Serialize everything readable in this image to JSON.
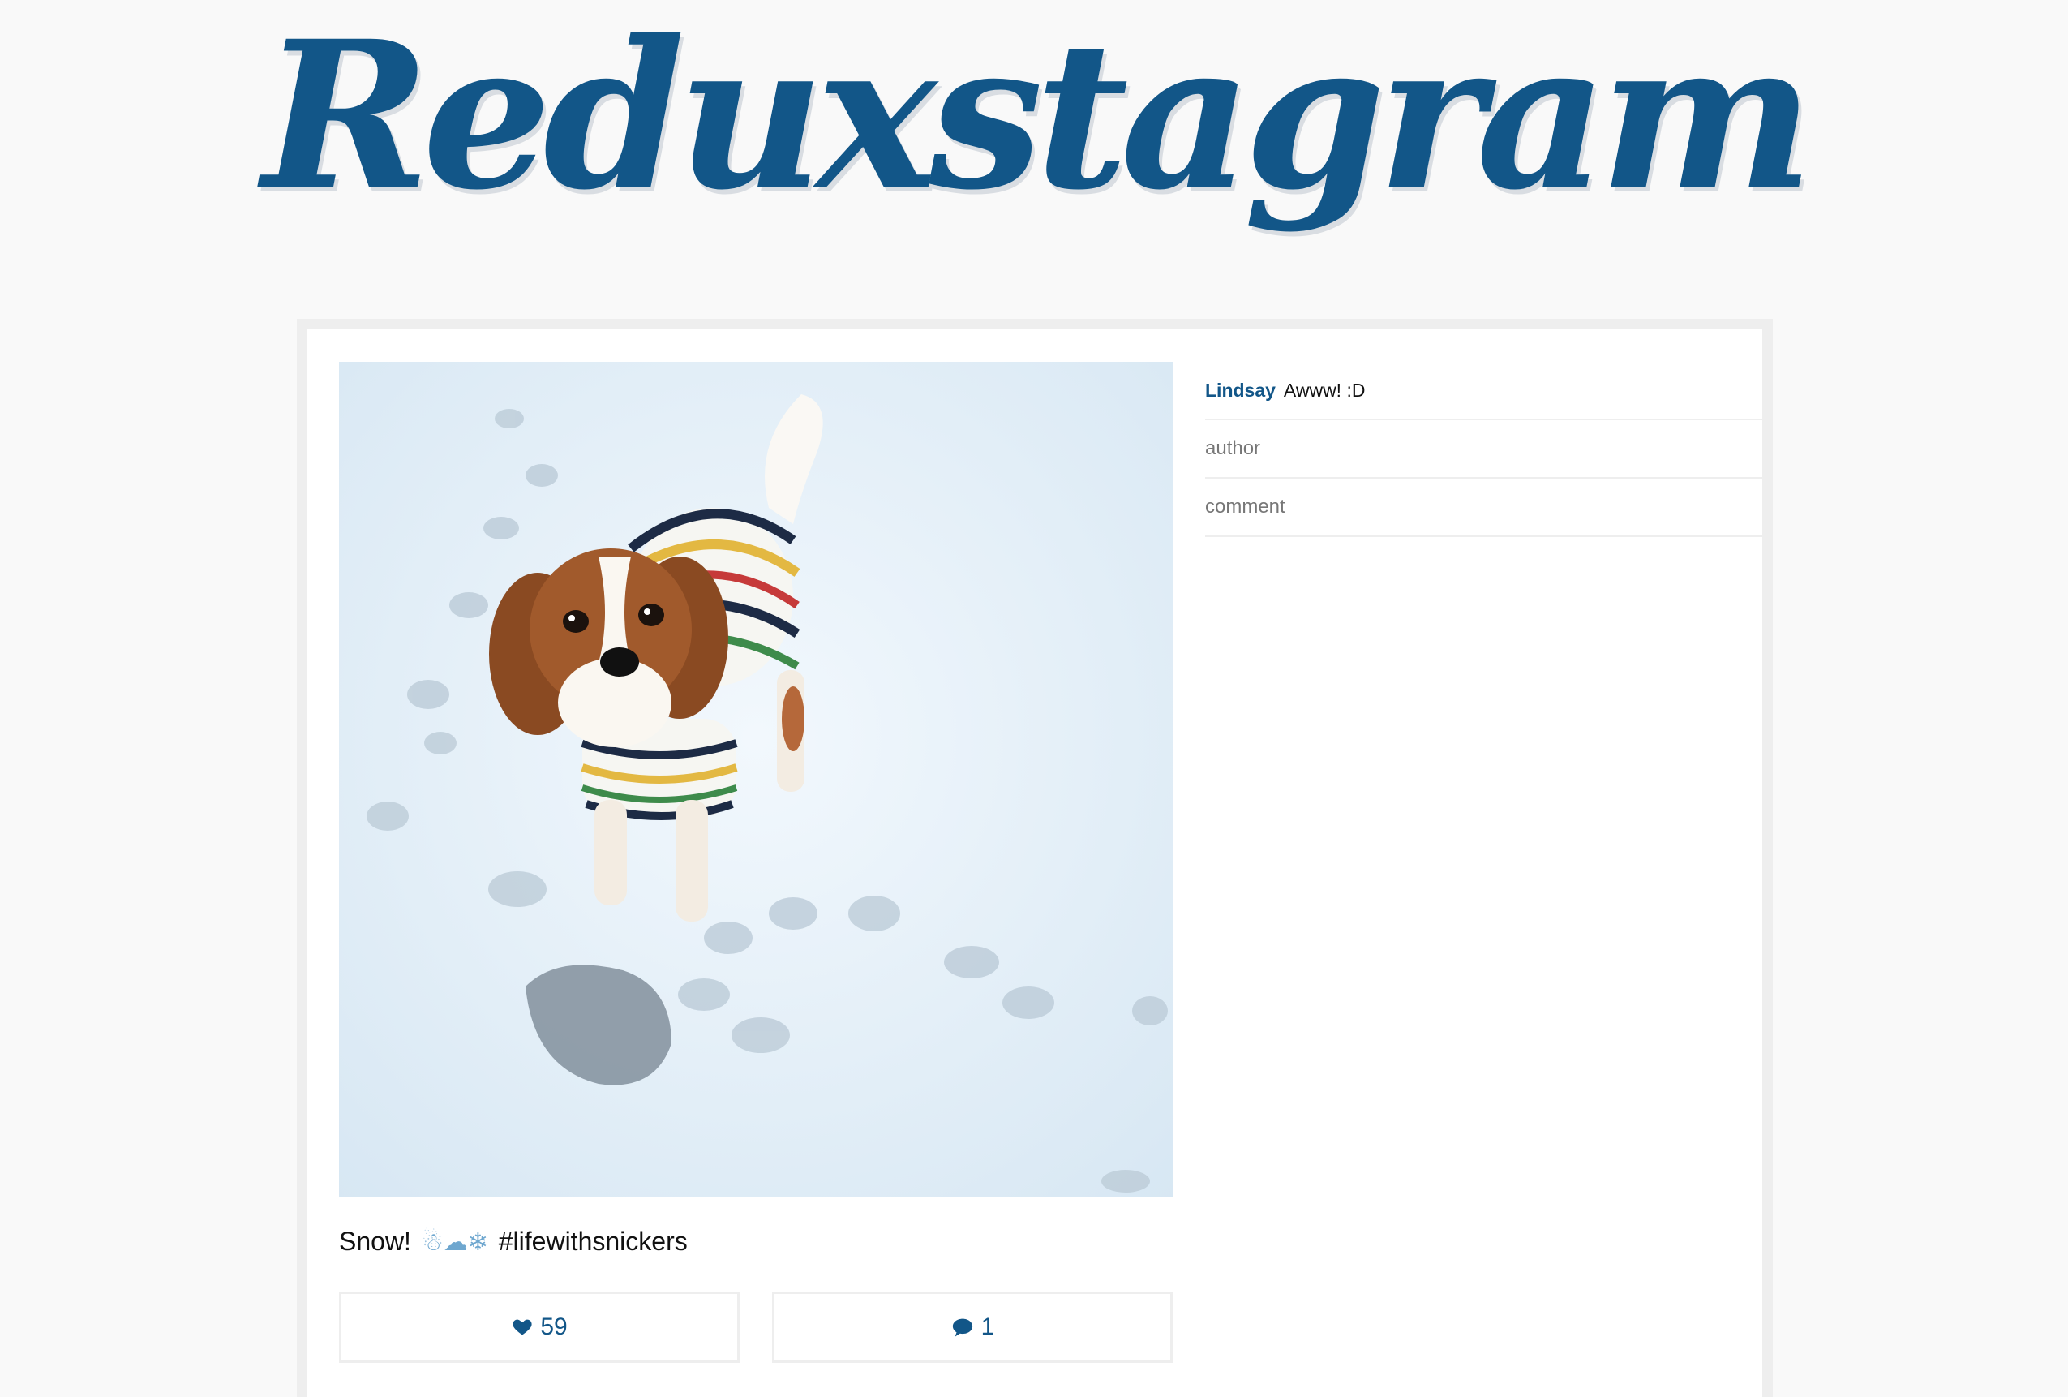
{
  "app": {
    "title": "Reduxstagram",
    "brand_color": "#125688"
  },
  "post": {
    "image_alt": "Dog in striped sweater standing in snow",
    "caption_text": "Snow!",
    "caption_emojis": "☃☁❄",
    "caption_hashtag": "#lifewithsnickers",
    "likes": "59",
    "comments_count": "1",
    "like_icon": "heart-icon",
    "comment_icon": "speech-bubble-icon"
  },
  "comments": [
    {
      "user": "Lindsay",
      "text": "Awww! :D"
    }
  ],
  "comment_form": {
    "author_placeholder": "author",
    "comment_placeholder": "comment"
  }
}
